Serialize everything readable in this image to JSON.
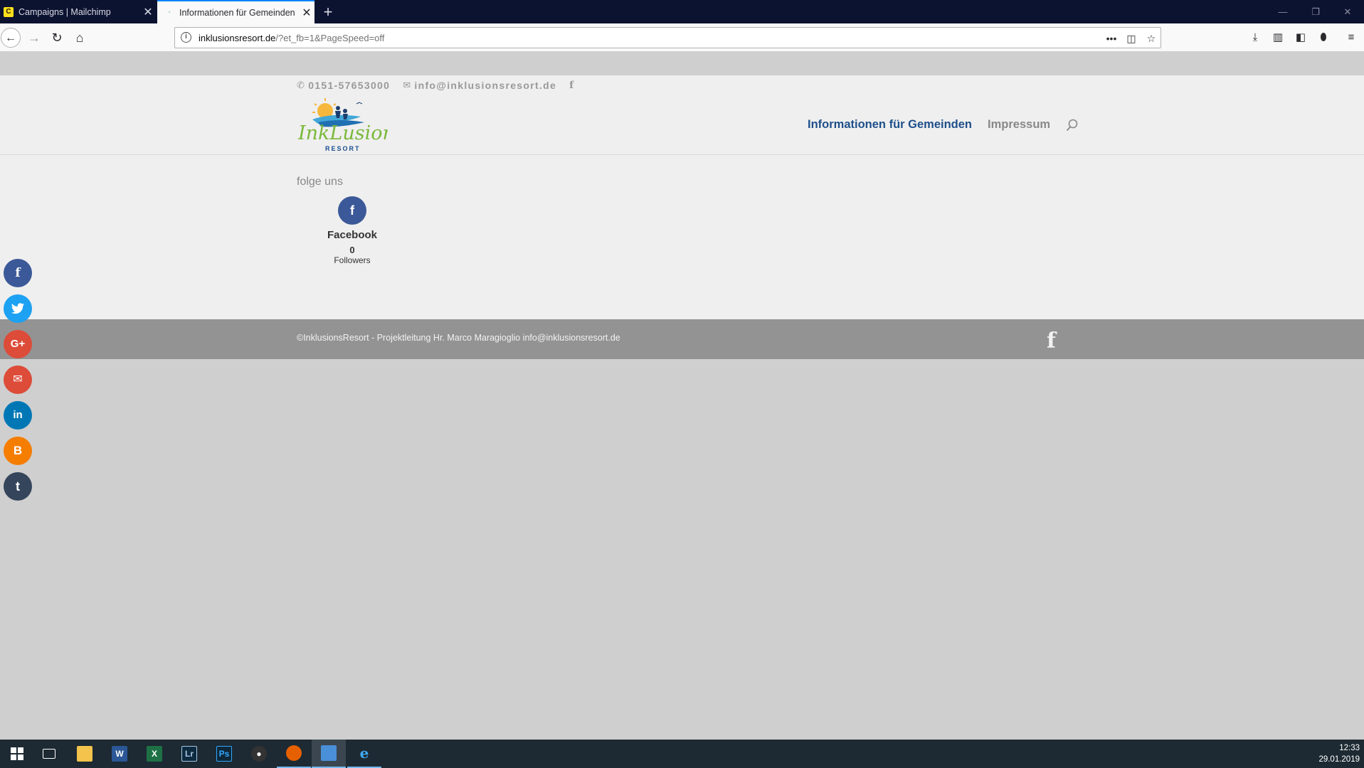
{
  "browser": {
    "tabs": [
      {
        "title": "Campaigns | Mailchimp",
        "favicon": "mailchimp-icon",
        "active": false
      },
      {
        "title": "Informationen für Gemeinden",
        "favicon": "loading-icon",
        "active": true
      }
    ],
    "url": {
      "host": "inklusionsresort.de",
      "path": "/?et_fb=1&PageSpeed=off"
    }
  },
  "site": {
    "phone": "0151-57653000",
    "email": "info@inklusionsresort.de",
    "logo_text": "InkLusions",
    "logo_subtext": "RESORT",
    "nav": [
      {
        "label": "Informationen für Gemeinden",
        "current": true
      },
      {
        "label": "Impressum",
        "current": false
      }
    ],
    "follow": {
      "title": "folge uns",
      "network": "Facebook",
      "count": "0",
      "count_label": "Followers"
    },
    "footer_text": "©InklusionsResort - Projektleitung Hr. Marco Maragioglio info@inklusionsresort.de"
  },
  "share_buttons": [
    {
      "name": "facebook",
      "glyph": "f",
      "color": "#3b5998"
    },
    {
      "name": "twitter",
      "glyph": "🐦",
      "color": "#1da1f2"
    },
    {
      "name": "google-plus",
      "glyph": "G+",
      "color": "#dd4b39"
    },
    {
      "name": "email",
      "glyph": "✉",
      "color": "#dd4b39"
    },
    {
      "name": "linkedin",
      "glyph": "in",
      "color": "#0077b5"
    },
    {
      "name": "blogger",
      "glyph": "B",
      "color": "#f57d00"
    },
    {
      "name": "tumblr",
      "glyph": "t",
      "color": "#35465c"
    }
  ],
  "taskbar": {
    "time": "12:33",
    "date": "29.01.2019"
  }
}
